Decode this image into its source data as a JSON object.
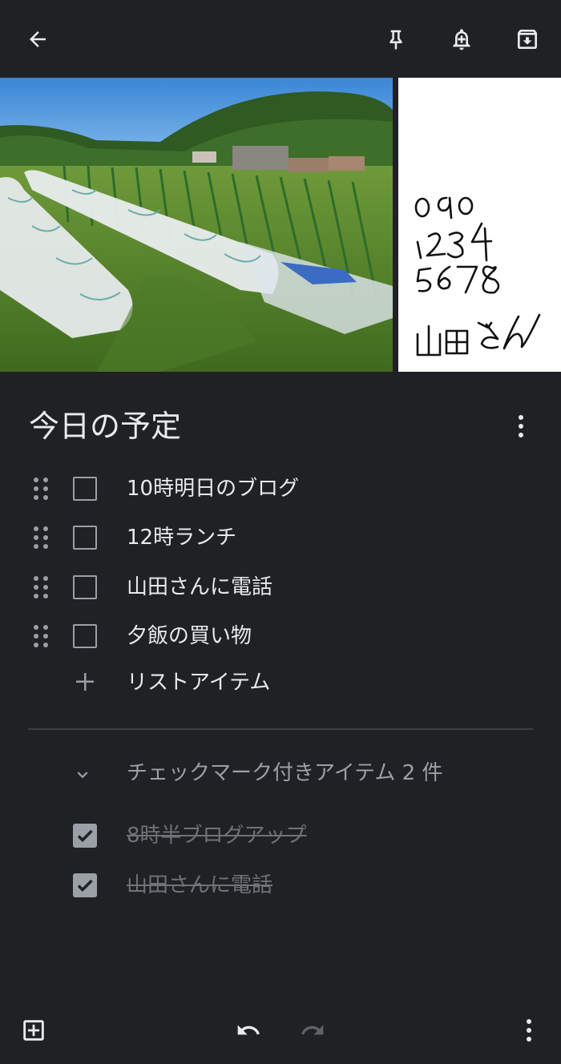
{
  "toolbar": {
    "back_icon": "arrow-back-icon",
    "pin_icon": "pin-icon",
    "reminder_icon": "bell-plus-icon",
    "archive_icon": "archive-icon"
  },
  "images": {
    "photo_alt": "field-photo",
    "drawing_lines": [
      "090",
      "1234",
      "5678",
      "山田さん"
    ]
  },
  "note": {
    "title": "今日の予定",
    "items": [
      {
        "text": "10時明日のブログ",
        "checked": false
      },
      {
        "text": "12時ランチ",
        "checked": false
      },
      {
        "text": "山田さんに電話",
        "checked": false
      },
      {
        "text": "夕飯の買い物",
        "checked": false
      }
    ],
    "add_item_label": "リストアイテム",
    "checked_header": "チェックマーク付きアイテム 2 件",
    "checked_items": [
      {
        "text": "8時半ブログアップ",
        "checked": true
      },
      {
        "text": "山田さんに電話",
        "checked": true
      }
    ]
  },
  "bottom": {
    "add_icon": "add-box-icon",
    "undo_icon": "undo-icon",
    "redo_icon": "redo-icon",
    "more_icon": "more-vert-icon"
  },
  "colors": {
    "background": "#202124",
    "text": "#e8eaed",
    "muted": "#9aa0a6",
    "done_text": "#6f7276"
  }
}
